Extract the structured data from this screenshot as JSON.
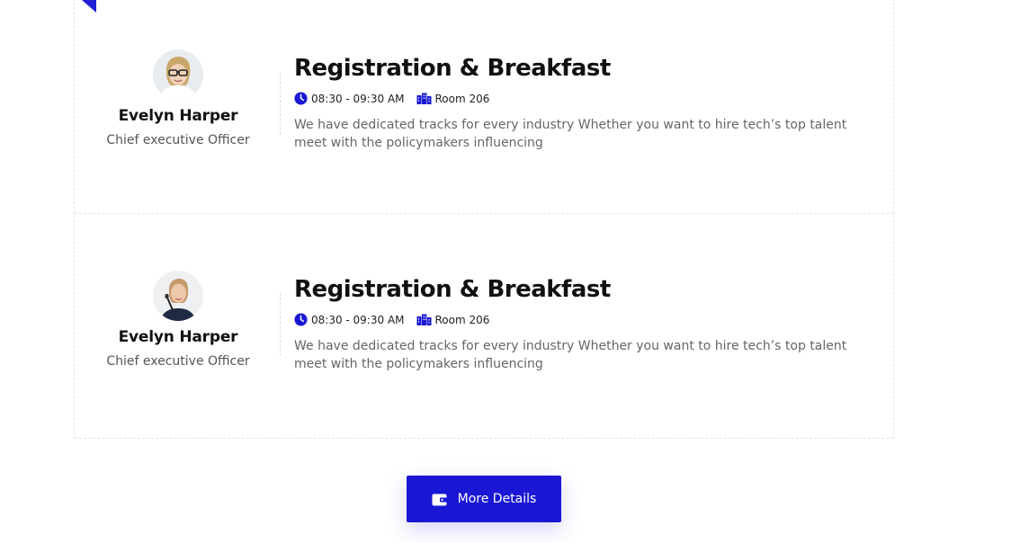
{
  "colors": {
    "accent": "#1a17d4",
    "text_dark": "#111111",
    "text_muted": "#666666"
  },
  "sessions": [
    {
      "speaker": {
        "name": "Evelyn Harper",
        "role": "Chief executive Officer",
        "avatar": "woman-with-glasses-avatar"
      },
      "title": "Registration & Breakfast",
      "time": "08:30 - 09:30 AM",
      "room": "Room 206",
      "description": "We have dedicated tracks for every industry Whether you want to hire tech’s top talent meet with the policymakers influencing"
    },
    {
      "speaker": {
        "name": "Evelyn Harper",
        "role": "Chief executive Officer",
        "avatar": "woman-speaking-at-microphone-avatar"
      },
      "title": "Registration & Breakfast",
      "time": "08:30 - 09:30 AM",
      "room": "Room 206",
      "description": "We have dedicated tracks for every industry Whether you want to hire tech’s top talent meet with the policymakers influencing"
    }
  ],
  "more_button": {
    "label": "More Details",
    "icon": "wallet-icon"
  }
}
